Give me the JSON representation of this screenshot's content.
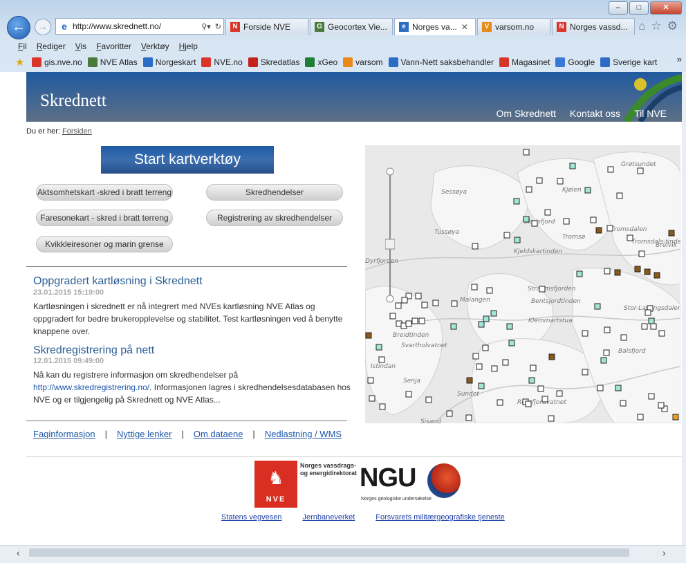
{
  "browser": {
    "url": "http://www.skrednett.no/",
    "tabs": [
      {
        "label": "Forside NVE",
        "color": "#d9362b",
        "fav": "N"
      },
      {
        "label": "Geocortex Vie...",
        "color": "#4a7a3a",
        "fav": "G"
      },
      {
        "label": "Norges va...",
        "color": "#2b6cc4",
        "fav": "e",
        "active": true
      },
      {
        "label": "varsom.no",
        "color": "#e88a1a",
        "fav": "V"
      },
      {
        "label": "Norges vassd...",
        "color": "#d9362b",
        "fav": "N"
      }
    ],
    "menu": [
      "Fil",
      "Rediger",
      "Vis",
      "Favoritter",
      "Verktøy",
      "Hjelp"
    ],
    "favorites": [
      {
        "label": "gis.nve.no",
        "color": "#d9362b"
      },
      {
        "label": "NVE Atlas",
        "color": "#4a7a3a"
      },
      {
        "label": "Norgeskart",
        "color": "#2b6cc4"
      },
      {
        "label": "NVE.no",
        "color": "#d9362b"
      },
      {
        "label": "Skredatlas",
        "color": "#c4221b"
      },
      {
        "label": "xGeo",
        "color": "#1e7e34"
      },
      {
        "label": "varsom",
        "color": "#e88a1a"
      },
      {
        "label": "Vann-Nett saksbehandler",
        "color": "#2b6cc4"
      },
      {
        "label": "Magasinet",
        "color": "#d9362b"
      },
      {
        "label": "Google",
        "color": "#3a78d8"
      },
      {
        "label": "Sverige kart",
        "color": "#2b6cc4"
      }
    ]
  },
  "site": {
    "title": "Skrednett",
    "top_links": [
      "Om Skrednett",
      "Kontakt oss",
      "Til NVE"
    ],
    "breadcrumb_prefix": "Du er her:",
    "breadcrumb_link": "Forsiden",
    "start_button": "Start kartverktøy",
    "buttons": [
      "Aktsomhetskart -skred i bratt terreng",
      "Skredhendelser",
      "Faresonekart - skred i bratt terreng",
      "Registrering av skredhendelser",
      "Kvikkleiresoner og marin grense"
    ],
    "news": [
      {
        "title": "Oppgradert kartløsning i Skrednett",
        "date": "23.01.2015 15:19:00",
        "body": "Kartløsningen i skrednett er nå integrert med NVEs kartløsning NVE Atlas og oppgradert for bedre brukeropplevelse og stabilitet. Test kartløsningen ved å benytte knappene over."
      },
      {
        "title": "Skredregistrering på nett",
        "date": "12.01.2015 09:49:00",
        "body_pre": "Nå kan du registrere informasjon om skredhendelser på",
        "body_link": "http://www.skredregistrering.no/",
        "body_post": ". Informasjonen lagres i skredhendelsesdatabasen hos NVE og er tilgjengelig på Skrednett og NVE Atlas..."
      }
    ],
    "footer_links": [
      "Faginformasjon",
      "Nyttige lenker",
      "Om dataene",
      "Nedlastning / WMS"
    ],
    "separator": "|",
    "nve_logo_text": "NVE",
    "nve_name": "Norges vassdrags- og energidirektorat",
    "ngu_logo": "NGU",
    "ngu_name": "Norges geologiske undersøkelse",
    "partners": [
      "Statens vegvesen",
      "Jernbaneverket",
      "Forsvarets militærgeografiske tjeneste"
    ]
  },
  "map": {
    "labels": [
      "Grøtsundet",
      "Sessøya",
      "Kjølen",
      "Skulsfjord",
      "Tussøya",
      "Tromsø",
      "Tromsdalen",
      "Tromsdals-tinden",
      "Breivik",
      "Kjeldskartinden",
      "Dyrfjorden",
      "Straumsfjorden",
      "Malangen",
      "Bentsjordtinden",
      "Stor-Lavangsdalen",
      "Klemmartstua",
      "Breidtinden",
      "Svartholvatnet",
      "Istindan",
      "Senja",
      "Sundet",
      "Rossfjordvatnet",
      "Balsfjord",
      "Sisand"
    ]
  }
}
